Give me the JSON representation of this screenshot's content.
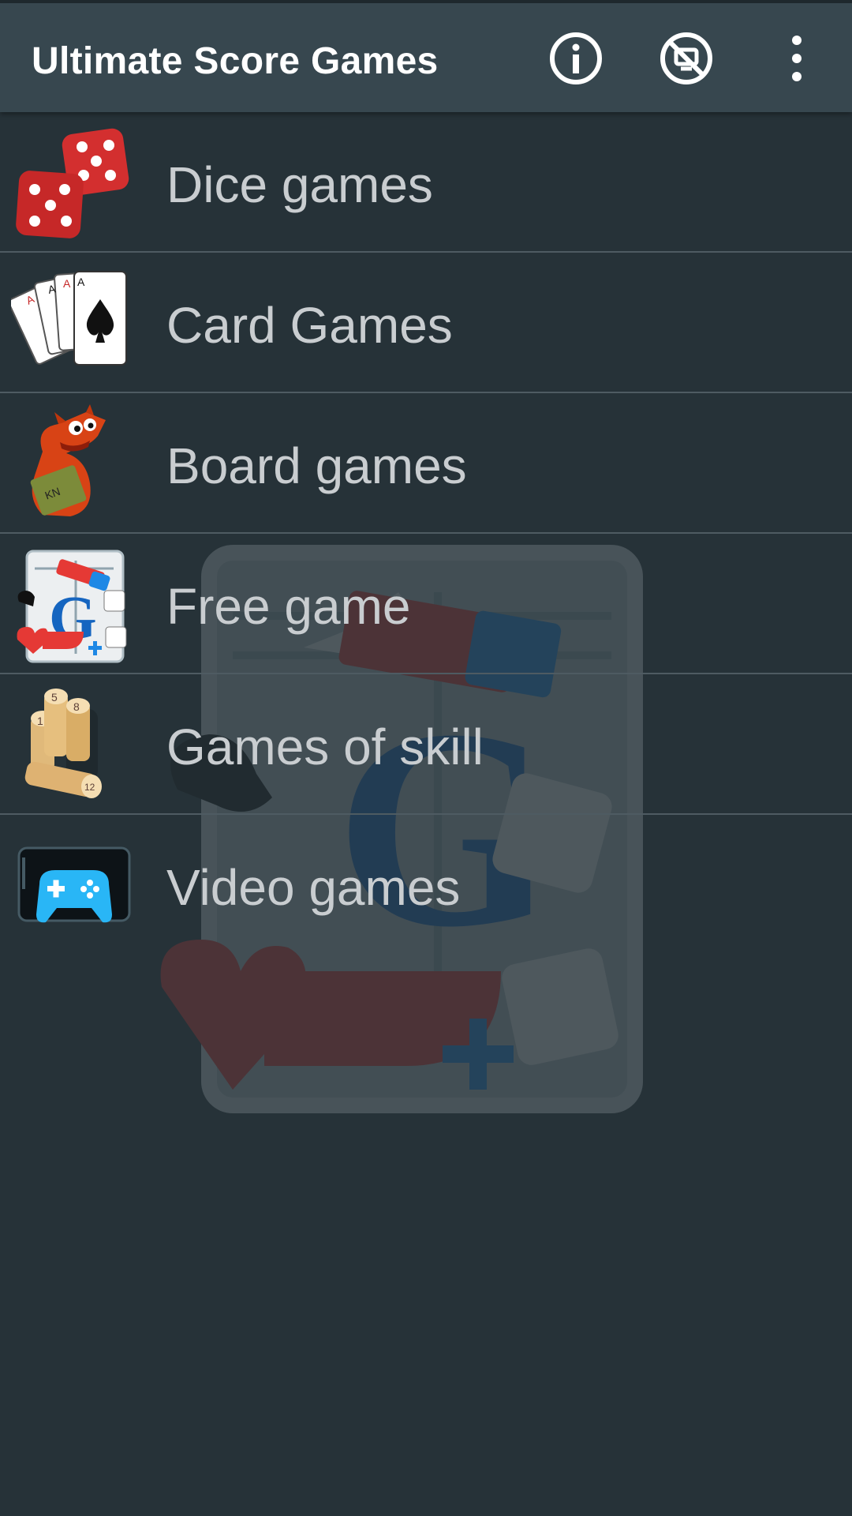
{
  "app": {
    "title": "Ultimate Score Games"
  },
  "toolbar": {
    "icons": [
      "info-icon",
      "no-ads-icon",
      "overflow-menu-icon"
    ]
  },
  "categories": [
    {
      "label": "Dice games",
      "icon": "dice-icon"
    },
    {
      "label": "Card Games",
      "icon": "playing-cards-icon"
    },
    {
      "label": "Board games",
      "icon": "dragon-reading-icon"
    },
    {
      "label": "Free game",
      "icon": "score-sheet-icon"
    },
    {
      "label": "Games of skill",
      "icon": "kubb-pins-icon"
    },
    {
      "label": "Video games",
      "icon": "gamepad-icon"
    }
  ],
  "colors": {
    "app_bar": "#37474f",
    "background": "#263238",
    "item_text": "#c9cdd0",
    "divider": "#4e5b62"
  }
}
